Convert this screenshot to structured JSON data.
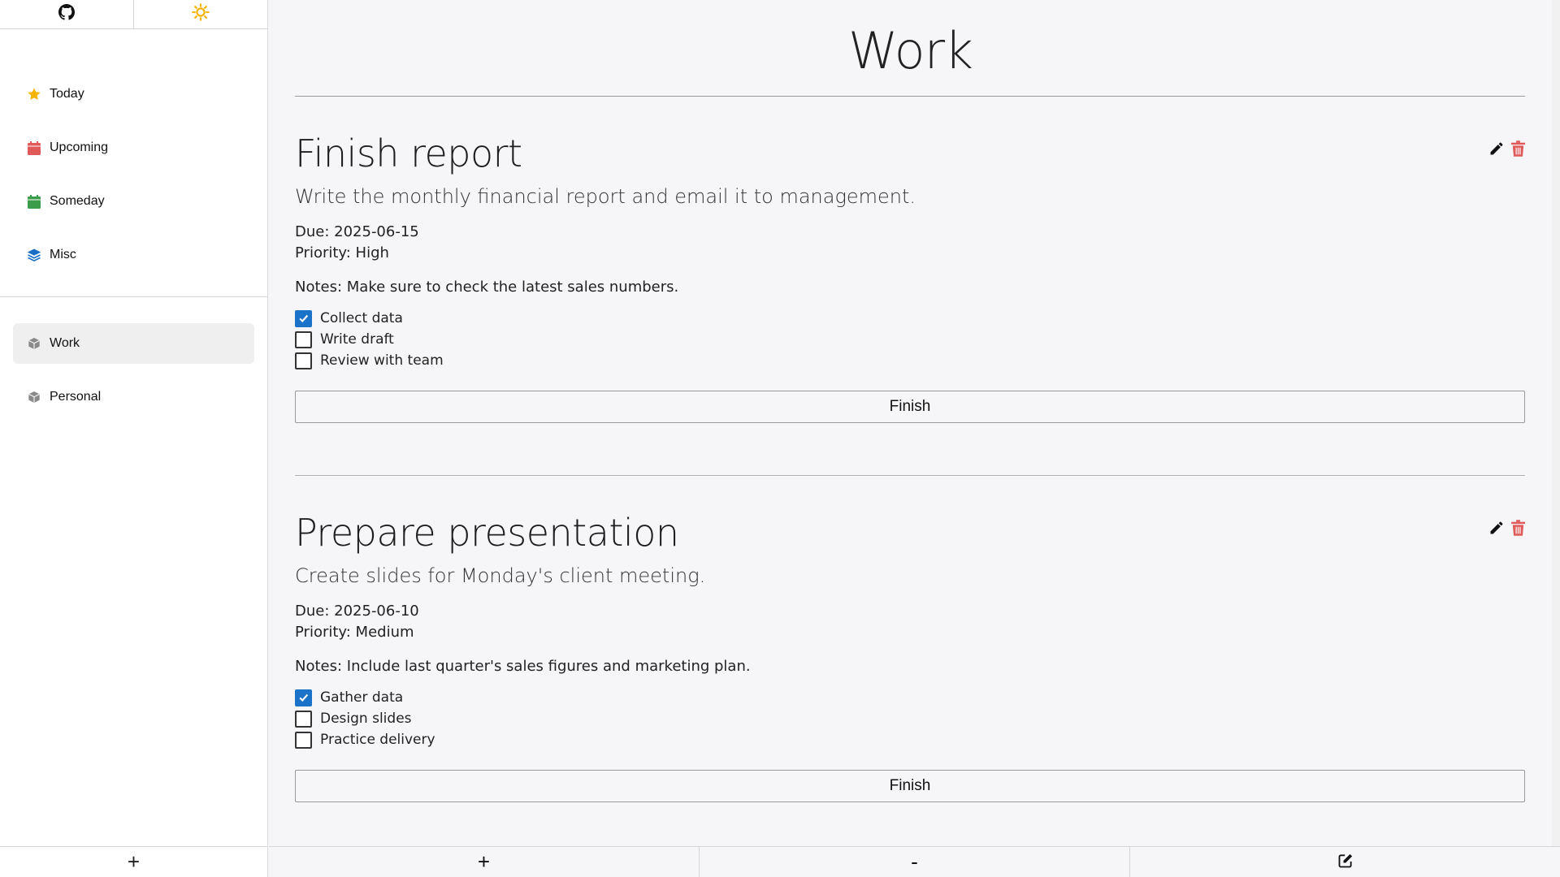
{
  "sidebar": {
    "top_icons": [
      {
        "icon": "github-icon"
      },
      {
        "icon": "sun-icon",
        "color": "#f5b400"
      }
    ],
    "nav_items": [
      {
        "label": "Today",
        "icon": "star-icon",
        "color": "#f5b400"
      },
      {
        "label": "Upcoming",
        "icon": "calendar-icon",
        "color": "#e05a5a"
      },
      {
        "label": "Someday",
        "icon": "calendar-icon",
        "color": "#3b9d4a"
      },
      {
        "label": "Misc",
        "icon": "layers-icon",
        "color": "#1a6fc4"
      }
    ],
    "projects": [
      {
        "label": "Work",
        "icon": "box-icon",
        "active": true
      },
      {
        "label": "Personal",
        "icon": "box-icon",
        "active": false
      }
    ],
    "add_label": "+"
  },
  "main": {
    "title": "Work",
    "tasks": [
      {
        "title": "Finish report",
        "description": "Write the monthly financial report and email it to management.",
        "due": "Due: 2025-06-15",
        "priority": "Priority: High",
        "notes": "Notes: Make sure to check the latest sales numbers.",
        "checklist": [
          {
            "label": "Collect data",
            "checked": true
          },
          {
            "label": "Write draft",
            "checked": false
          },
          {
            "label": "Review with team",
            "checked": false
          }
        ],
        "finish_label": "Finish"
      },
      {
        "title": "Prepare presentation",
        "description": "Create slides for Monday's client meeting.",
        "due": "Due: 2025-06-10",
        "priority": "Priority: Medium",
        "notes": "Notes: Include last quarter's sales figures and marketing plan.",
        "checklist": [
          {
            "label": "Gather data",
            "checked": true
          },
          {
            "label": "Design slides",
            "checked": false
          },
          {
            "label": "Practice delivery",
            "checked": false
          }
        ],
        "finish_label": "Finish"
      }
    ]
  },
  "toolbar": {
    "add_label": "+",
    "remove_label": "-",
    "edit_icon": "edit-icon"
  },
  "colors": {
    "accent": "#1a73c8",
    "delete": "#e05a5a",
    "sun": "#f5b400"
  }
}
